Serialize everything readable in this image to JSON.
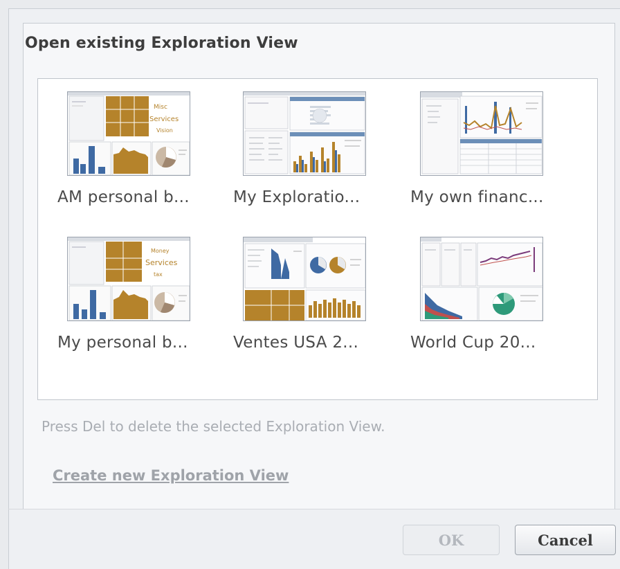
{
  "dialog": {
    "title": "Open existing Exploration View",
    "hint": "Press Del to delete the selected Exploration View.",
    "create_link": "Create new Exploration View",
    "ok_label": "OK",
    "cancel_label": "Cancel"
  },
  "views": [
    {
      "label": "AM personal b..."
    },
    {
      "label": "My Exploratio..."
    },
    {
      "label": "My own financ..."
    },
    {
      "label": "My personal b..."
    },
    {
      "label": "Ventes USA 2..."
    },
    {
      "label": "World Cup 20..."
    }
  ],
  "colors": {
    "gold": "#b5832b",
    "blue": "#3f6aa3",
    "teal": "#2e9a7a",
    "red": "#c0504d",
    "purple": "#7a3a7a"
  }
}
